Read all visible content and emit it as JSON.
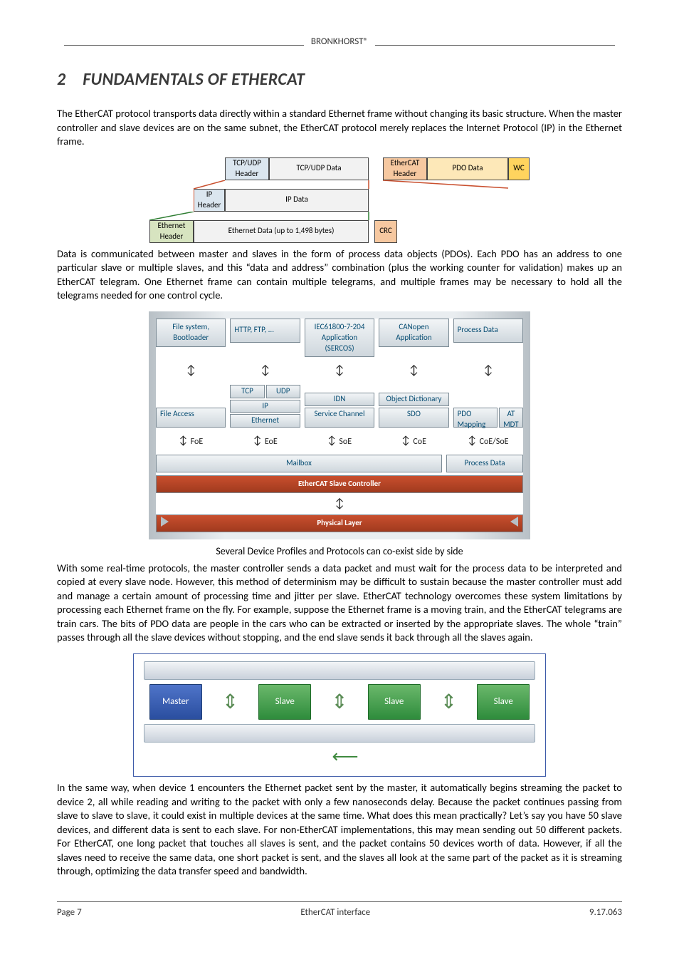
{
  "header": {
    "brand": "BRONKHORST®"
  },
  "heading": {
    "number": "2",
    "title": "FUNDAMENTALS OF ETHERCAT"
  },
  "paragraphs": {
    "p1": "The EtherCAT protocol transports data directly within a standard Ethernet frame without changing its basic structure. When the master controller and slave devices are on the same subnet, the EtherCAT protocol merely replaces the Internet Protocol (IP) in the Ethernet frame.",
    "p2": "Data is communicated between master and slaves in the form of process data objects (PDOs). Each PDO has an address to one particular slave or multiple slaves, and this “data and address” combination (plus the working counter for validation) makes up an EtherCAT telegram. One Ethernet frame can contain multiple telegrams, and multiple frames may be necessary to hold all the telegrams needed for one control cycle.",
    "caption2": "Several Device Profiles and Protocols can co-exist side by side",
    "p3": "With some real-time protocols, the master controller sends a data packet and must wait for the process data to be interpreted and copied at every slave node. However, this method of determinism may be difficult to sustain because the master controller must add and manage a certain amount of processing time and jitter per slave. EtherCAT technology overcomes these system limitations by processing each Ethernet frame on the fly. For example, suppose the Ethernet frame is a moving train, and the EtherCAT telegrams are train cars. The bits of PDO data are people in the cars who can be extracted or inserted by the appropriate slaves. The whole “train” passes through all the slave devices without stopping, and the end slave sends it back through all the slaves again.",
    "p4": "In the same way, when device 1 encounters the Ethernet packet sent by the master, it automatically begins streaming the packet to device 2, all while reading and writing to the packet with only a few nanoseconds delay. Because the packet continues passing from slave to slave to slave, it could exist in multiple devices at the same time. What does this mean practically? Let’s say you have 50 slave devices, and different data is sent to each slave. For non-EtherCAT implementations, this may mean sending out 50 different packets. For EtherCAT, one long packet that touches all slaves is sent, and the packet contains 50 devices worth of data. However, if all the slaves need to receive the same data, one short packet is sent, and the slaves all look at the same part of the packet as it is streaming through, optimizing the data transfer speed and bandwidth."
  },
  "fig1": {
    "tcp_header": "TCP/UDP Header",
    "tcp_data": "TCP/UDP Data",
    "ecat_header": "EtherCAT Header",
    "pdo_data": "PDO Data",
    "wc": "WC",
    "ip_header": "IP Header",
    "ip_data": "IP Data",
    "eth_header": "Ethernet Header",
    "eth_data": "Ethernet Data (up to 1,498 bytes)",
    "crc": "CRC"
  },
  "fig2": {
    "row1": [
      "File system, Bootloader",
      "HTTP, FTP, ...",
      "IEC61800-7-204 Application (SERCOS)",
      "CANopen Application",
      "Process Data"
    ],
    "labels": {
      "file_access": "File Access",
      "tcp": "TCP",
      "udp": "UDP",
      "ip": "IP",
      "ethernet": "Ethernet",
      "idn": "IDN",
      "service_channel": "Service Channel",
      "obj_dict": "Object Dictionary",
      "sdo": "SDO",
      "pdo_map": "PDO Mapping",
      "at_mdt": "AT MDT",
      "foe": "FoE",
      "eoe": "EoE",
      "soe": "SoE",
      "coe": "CoE",
      "coesoe": "CoE/SoE",
      "mailbox": "Mailbox",
      "process_data": "Process Data",
      "esc": "EtherCAT Slave Controller",
      "physical": "Physical Layer"
    }
  },
  "fig3": {
    "master": "Master",
    "slave": "Slave"
  },
  "footer": {
    "page": "Page 7",
    "title": "EtherCAT interface",
    "doc": "9.17.063"
  }
}
